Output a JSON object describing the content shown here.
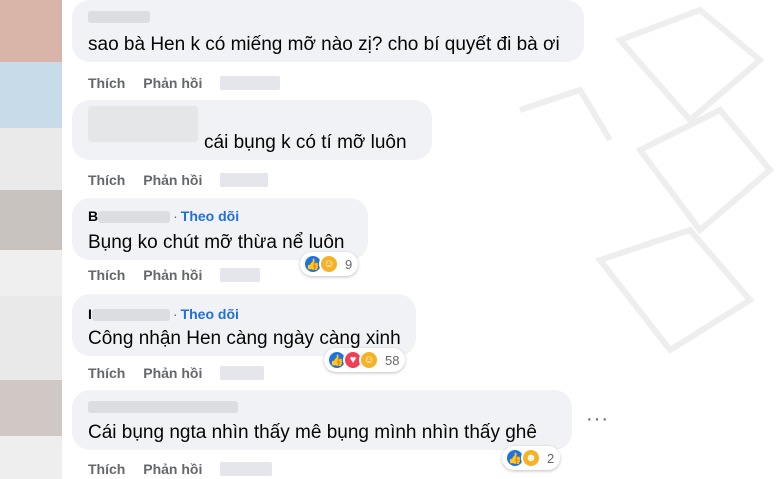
{
  "comments": [
    {
      "author": "",
      "follow": "",
      "text": "sao bà Hen k có miếng mỡ nào zị? cho bí quyết đi bà ơi",
      "like": "Thích",
      "reply": "Phản hồi",
      "reactions": [],
      "count": ""
    },
    {
      "author": "",
      "follow": "",
      "text": "cái bụng k có tí mỡ luôn",
      "like": "Thích",
      "reply": "Phản hồi",
      "reactions": [],
      "count": ""
    },
    {
      "author": "B",
      "follow": "Theo dõi",
      "text": "Bụng ko chút mỡ thừa nể luôn",
      "like": "Thích",
      "reply": "Phản hồi",
      "reactions": [
        "like-icon",
        "care-icon"
      ],
      "count": "9"
    },
    {
      "author": "I",
      "follow": "Theo dõi",
      "text": "Công nhận Hen càng ngày càng xinh",
      "like": "Thích",
      "reply": "Phản hồi",
      "reactions": [
        "like-icon",
        "love-icon",
        "care-icon"
      ],
      "count": "58"
    },
    {
      "author": "",
      "follow": "",
      "text": "Cái bụng ngta nhìn thấy mê bụng mình nhìn thấy ghê",
      "like": "Thích",
      "reply": "Phản hồi",
      "reactions": [
        "like-icon",
        "haha-icon"
      ],
      "count": "2"
    }
  ],
  "more_icon": "more-options-icon",
  "colors": {
    "bubble": "#f0f2f5",
    "follow": "#216fdb",
    "meta": "#65676b",
    "like": "#1b74e4"
  }
}
